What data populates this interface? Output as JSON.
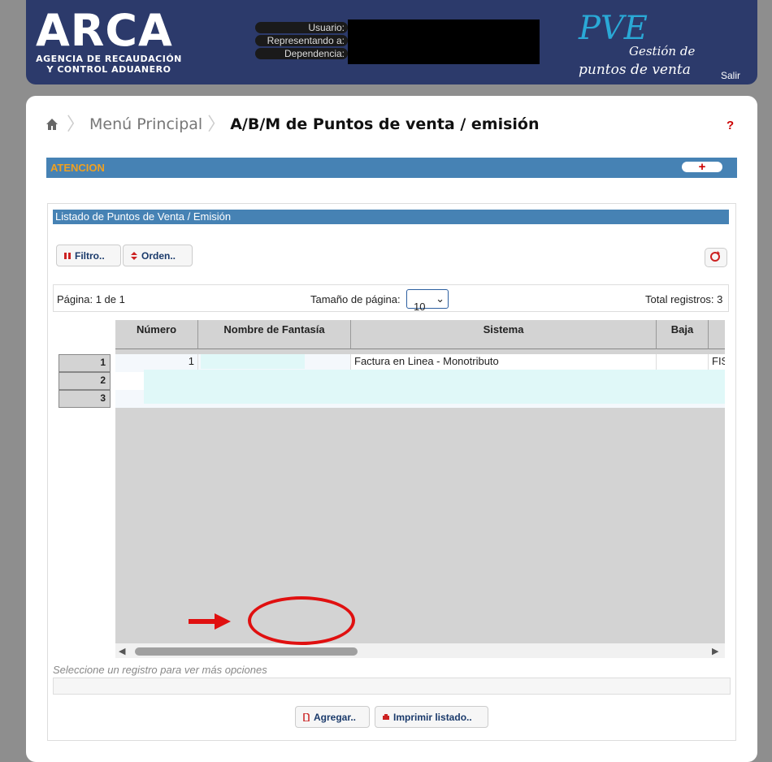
{
  "header": {
    "logo": "ARCA",
    "logo_sub_1": "AGENCIA DE RECAUDACIÓN",
    "logo_sub_2": "Y CONTROL ADUANERO",
    "user_labels": [
      "Usuario:",
      "Representando a:",
      "Dependencia:"
    ],
    "app_name": "PVE",
    "app_sub_1": "Gestión de",
    "app_sub_2": "puntos de venta",
    "logout": "Salir"
  },
  "breadcrumb": {
    "home": "home-icon",
    "menu": "Menú Principal",
    "current": "A/B/M de Puntos de venta / emisión",
    "help": "?"
  },
  "attention": {
    "label": "ATENCION",
    "toggle": "+"
  },
  "listing": {
    "title": "Listado de Puntos de Venta / Emisión",
    "filter_button": "Filtro..",
    "order_button": "Orden..",
    "pager": {
      "page": "Página: 1 de 1",
      "size_label": "Tamaño de página:",
      "size_value": "10",
      "total": "Total registros: 3"
    },
    "columns": [
      "Número",
      "Nombre de Fantasía",
      "Sistema",
      "Baja",
      ""
    ],
    "rows": [
      {
        "index": "1",
        "numero": "1",
        "sistema": "Factura en Linea - Monotributo",
        "baja": "",
        "extra": "FIS"
      },
      {
        "index": "2",
        "numero": "",
        "sistema": "",
        "baja": "",
        "extra": ""
      },
      {
        "index": "3",
        "numero": "",
        "sistema": "",
        "baja": "",
        "extra": ""
      }
    ],
    "hint": "Seleccione un registro para ver más opciones",
    "add_button": "Agregar..",
    "print_button": "Imprimir listado.."
  },
  "colors": {
    "header_bg": "#2c3a6b",
    "accent_blue": "#4682b4",
    "warning": "#f0a020",
    "annotation_red": "#e01010"
  }
}
